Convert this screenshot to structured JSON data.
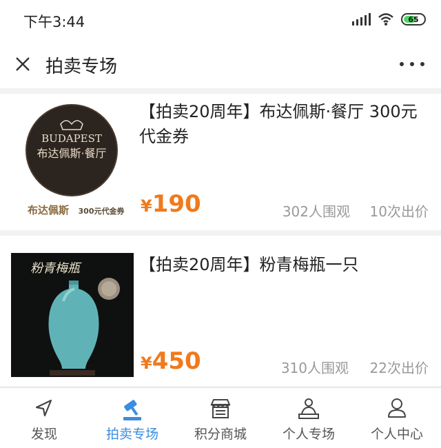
{
  "status_bar": {
    "time": "下午3:44",
    "battery": "65",
    "battery_level": 0.65
  },
  "header": {
    "title": "拍卖专场"
  },
  "items": [
    {
      "title": "【拍卖20周年】布达佩斯·餐厅 300元代金券",
      "price_symbol": "¥",
      "price": "190",
      "views": "302人围观",
      "bids": "10次出价",
      "image": {
        "logo_top": "BUDAPEST",
        "logo_bottom": "布达佩斯·餐厅",
        "caption_main": "布达佩斯",
        "caption_sub": "300元代金券"
      }
    },
    {
      "title": "【拍卖20周年】粉青梅瓶一只",
      "price_symbol": "¥",
      "price": "450",
      "views": "310人围观",
      "bids": "22次出价",
      "image": {
        "calligraphy": "粉青梅瓶"
      }
    }
  ],
  "tabs": [
    {
      "label": "发现",
      "icon": "navigation-arrow-icon",
      "active": false
    },
    {
      "label": "拍卖专场",
      "icon": "auction-gavel-icon",
      "active": true
    },
    {
      "label": "积分商城",
      "icon": "store-icon",
      "active": false
    },
    {
      "label": "个人专场",
      "icon": "person-showcase-icon",
      "active": false
    },
    {
      "label": "个人中心",
      "icon": "user-icon",
      "active": false
    }
  ],
  "colors": {
    "accent": "#3b8de0",
    "price": "#f07a1c",
    "muted": "#999999"
  }
}
